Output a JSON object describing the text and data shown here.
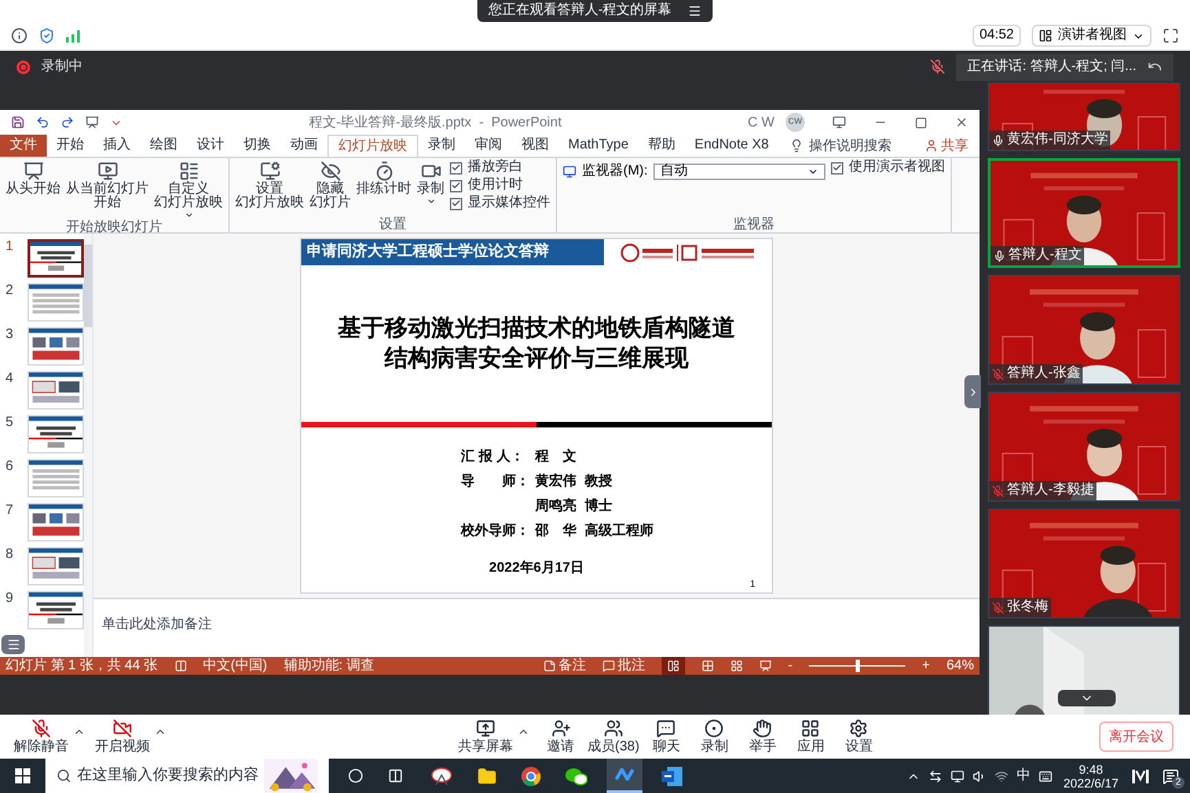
{
  "banner": {
    "text": "您正在观看答辩人-程文的屏幕"
  },
  "meeting_bar": {
    "timer": "04:52",
    "view_button": "演讲者视图"
  },
  "recording": {
    "label": "录制中"
  },
  "speaking": {
    "text": "正在讲话: 答辩人-程文; 闫..."
  },
  "ppt": {
    "title": "程文-毕业答辩-最终版.pptx  -  PowerPoint",
    "user_initials": "C W",
    "avatar": "CW",
    "tabs": [
      {
        "label": "文件",
        "kind": "file",
        "selected": false
      },
      {
        "label": "开始",
        "kind": "tab",
        "selected": false
      },
      {
        "label": "插入",
        "kind": "tab",
        "selected": false
      },
      {
        "label": "绘图",
        "kind": "tab",
        "selected": false
      },
      {
        "label": "设计",
        "kind": "tab",
        "selected": false
      },
      {
        "label": "切换",
        "kind": "tab",
        "selected": false
      },
      {
        "label": "动画",
        "kind": "tab",
        "selected": false
      },
      {
        "label": "幻灯片放映",
        "kind": "tab",
        "selected": true
      },
      {
        "label": "录制",
        "kind": "tab",
        "selected": false
      },
      {
        "label": "审阅",
        "kind": "tab",
        "selected": false
      },
      {
        "label": "视图",
        "kind": "tab",
        "selected": false
      },
      {
        "label": "MathType",
        "kind": "tab",
        "selected": false
      },
      {
        "label": "帮助",
        "kind": "tab",
        "selected": false
      },
      {
        "label": "EndNote X8",
        "kind": "tab",
        "selected": false
      }
    ],
    "search": "操作说明搜索",
    "share": "共享",
    "groups": [
      {
        "label": "开始放映幻灯片",
        "buttons": [
          {
            "lines": [
              "从头开始"
            ],
            "caret": false
          },
          {
            "lines": [
              "从当前幻灯片",
              "开始"
            ],
            "caret": false
          },
          {
            "lines": [
              "自定义",
              "幻灯片放映"
            ],
            "caret": true
          }
        ]
      },
      {
        "label": "设置",
        "buttons": [
          {
            "lines": [
              "设置",
              "幻灯片放映"
            ],
            "caret": false
          },
          {
            "lines": [
              "隐藏",
              "幻灯片"
            ],
            "caret": false
          },
          {
            "lines": [
              "排练计时"
            ],
            "caret": false
          },
          {
            "lines": [
              "录制"
            ],
            "caret": true
          }
        ],
        "checks": [
          {
            "label": "播放旁白",
            "checked": true
          },
          {
            "label": "使用计时",
            "checked": true
          },
          {
            "label": "显示媒体控件",
            "checked": true
          }
        ]
      },
      {
        "label": "监视器",
        "select": {
          "label": "监视器(M):",
          "value": "自动"
        },
        "checks": [
          {
            "label": "使用演示者视图",
            "checked": true
          }
        ]
      }
    ],
    "thumbnails": [
      {
        "number": "1",
        "selected": true
      },
      {
        "number": "2",
        "selected": false
      },
      {
        "number": "3",
        "selected": false
      },
      {
        "number": "4",
        "selected": false
      },
      {
        "number": "5",
        "selected": false
      },
      {
        "number": "6",
        "selected": false
      },
      {
        "number": "7",
        "selected": false
      },
      {
        "number": "8",
        "selected": false
      },
      {
        "number": "9",
        "selected": false
      }
    ],
    "slide": {
      "header": "申请同济大学工程硕士学位论文答辩",
      "title": [
        "基于移动激光扫描技术的地铁盾构隧道",
        "结构病害安全评价与三维展现"
      ],
      "info": [
        {
          "label": "汇 报 人：",
          "value": "程　文"
        },
        {
          "label": "导　　师：",
          "value": "黄宏伟  教授"
        },
        {
          "value": "周鸣亮  博士"
        },
        {
          "label": "校外导师：",
          "value": "邵　华  高级工程师"
        }
      ],
      "date": "2022年6月17日",
      "page": "1"
    },
    "notes_placeholder": "单击此处添加备注",
    "status": {
      "slide_info": "幻灯片 第 1 张，共 44 张",
      "language": "中文(中国)",
      "accessibility": "辅助功能: 调查",
      "notes": "备注",
      "comments": "批注",
      "zoom_minus": "-",
      "zoom_plus": "+",
      "zoom": {
        "level": 0.5
      },
      "zoom_percent": "64%"
    }
  },
  "videos": [
    {
      "name": "黄宏伟-同济大学",
      "muted": false,
      "speaking": false
    },
    {
      "name": "答辩人-程文",
      "muted": false,
      "speaking": true
    },
    {
      "name": "答辩人-张鑫",
      "muted": true,
      "speaking": false
    },
    {
      "name": "答辩人-李毅捷",
      "muted": true,
      "speaking": false
    },
    {
      "name": "张冬梅",
      "muted": true,
      "speaking": false
    },
    {
      "kind": "picture",
      "speaking": false
    }
  ],
  "toolbar": {
    "buttons": [
      {
        "label": "解除静音",
        "caret": true
      },
      {
        "label": "开启视频",
        "caret": true
      },
      {
        "label": "共享屏幕",
        "caret": true
      },
      {
        "label": "邀请",
        "caret": false
      },
      {
        "label": "成员(38)",
        "caret": false
      },
      {
        "label": "聊天",
        "caret": false
      },
      {
        "label": "录制",
        "caret": false
      },
      {
        "label": "举手",
        "caret": false
      },
      {
        "label": "应用",
        "caret": false
      },
      {
        "label": "设置",
        "caret": false
      }
    ],
    "leave": "离开会议"
  },
  "taskbar": {
    "search_placeholder": "在这里输入你要搜索的内容",
    "ime": "中",
    "time": "9:48",
    "date": "2022/6/17",
    "notifications": "2"
  }
}
